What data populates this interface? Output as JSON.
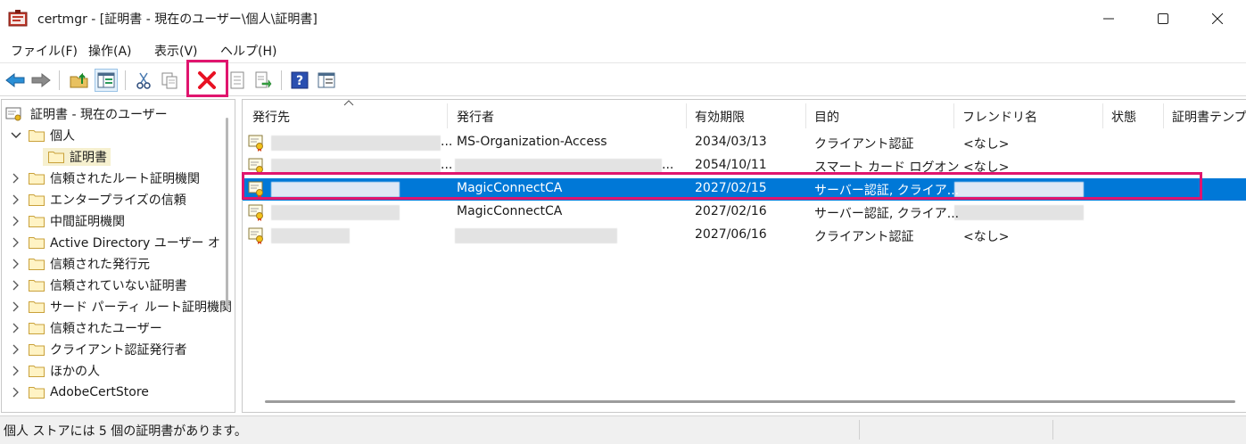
{
  "window": {
    "title": "certmgr - [証明書 - 現在のユーザー\\個人\\証明書]"
  },
  "menu": {
    "file": "ファイル(F)",
    "action": "操作(A)",
    "view": "表示(V)",
    "help": "ヘルプ(H)"
  },
  "toolbar": {
    "icons": [
      "back-arrow-icon",
      "forward-arrow-icon",
      "up-folder-icon",
      "show-hide-tree-icon",
      "cut-icon",
      "copy-icon",
      "delete-icon",
      "properties-icon",
      "export-icon",
      "help-icon",
      "console-view-icon"
    ]
  },
  "tree": {
    "root": "証明書 - 現在のユーザー",
    "personal": "個人",
    "certificates": "証明書",
    "items": [
      "信頼されたルート証明機関",
      "エンタープライズの信頼",
      "中間証明機関",
      "Active Directory ユーザー オ",
      "信頼された発行元",
      "信頼されていない証明書",
      "サード パーティ ルート証明機関",
      "信頼されたユーザー",
      "クライアント認証発行者",
      "ほかの人",
      "AdobeCertStore"
    ]
  },
  "list": {
    "columns": {
      "issued_to": "発行先",
      "issued_by": "発行者",
      "expiration": "有効期限",
      "purpose": "目的",
      "friendly_name": "フレンドリ名",
      "status": "状態",
      "template": "証明書テンプ"
    },
    "rows": [
      {
        "issued_to": "...",
        "issued_by": "MS-Organization-Access",
        "expiration": "2034/03/13",
        "purpose": "クライアント認証",
        "friendly_name": "<なし>"
      },
      {
        "issued_to": "...",
        "issued_by": "...",
        "expiration": "2054/10/11",
        "purpose": "スマート カード ログオン",
        "friendly_name": "<なし>"
      },
      {
        "issued_to": "",
        "issued_by": "MagicConnectCA",
        "expiration": "2027/02/15",
        "purpose": "サーバー認証, クライア...",
        "friendly_name": ""
      },
      {
        "issued_to": "",
        "issued_by": "MagicConnectCA",
        "expiration": "2027/02/16",
        "purpose": "サーバー認証, クライア...",
        "friendly_name": ""
      },
      {
        "issued_to": "",
        "issued_by": "",
        "expiration": "2027/06/16",
        "purpose": "クライアント認証",
        "friendly_name": "<なし>"
      }
    ],
    "selected_row": 2
  },
  "status": {
    "text": "個人 ストアには 5 個の証明書があります。"
  },
  "colors": {
    "selection": "#0078d7",
    "highlight_annotation": "#e0156e",
    "delete_red": "#e81123"
  }
}
